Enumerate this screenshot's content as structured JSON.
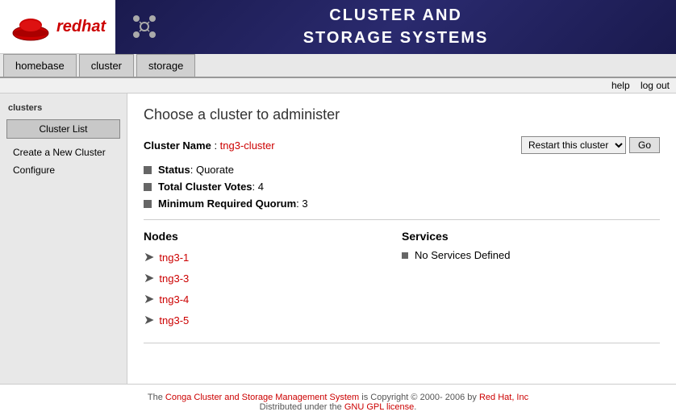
{
  "header": {
    "banner_title_line1": "CLUSTER AND",
    "banner_title_line2": "STORAGE SYSTEMS",
    "redhat_label": "redhat"
  },
  "navbar": {
    "tabs": [
      {
        "id": "homebase",
        "label": "homebase"
      },
      {
        "id": "cluster",
        "label": "cluster"
      },
      {
        "id": "storage",
        "label": "storage"
      }
    ]
  },
  "toplinks": {
    "help": "help",
    "logout": "log out"
  },
  "sidebar": {
    "title": "clusters",
    "cluster_list_btn": "Cluster List",
    "create_link": "Create a New Cluster",
    "configure_link": "Configure"
  },
  "content": {
    "heading": "Choose a cluster to administer",
    "cluster_name_label": "Cluster Name",
    "cluster_name_value": "tng3-cluster",
    "restart_option": "Restart this cluster",
    "go_label": "Go",
    "status_label": "Status",
    "status_value": "Quorate",
    "total_votes_label": "Total Cluster Votes",
    "total_votes_value": "4",
    "min_quorum_label": "Minimum Required Quorum",
    "min_quorum_value": "3",
    "nodes_heading": "Nodes",
    "nodes": [
      {
        "id": "n1",
        "label": "tng3-1"
      },
      {
        "id": "n2",
        "label": "tng3-3"
      },
      {
        "id": "n3",
        "label": "tng3-4"
      },
      {
        "id": "n4",
        "label": "tng3-5"
      }
    ],
    "services_heading": "Services",
    "no_services": "No Services Defined"
  },
  "footer": {
    "prefix": "The ",
    "link_text": "Conga Cluster and Storage Management System",
    "suffix": " is Copyright © 2000- 2006 by ",
    "company": "Red Hat, Inc",
    "dist_text": "Distributed under the ",
    "license_link": "GNU GPL license",
    "period": "."
  }
}
